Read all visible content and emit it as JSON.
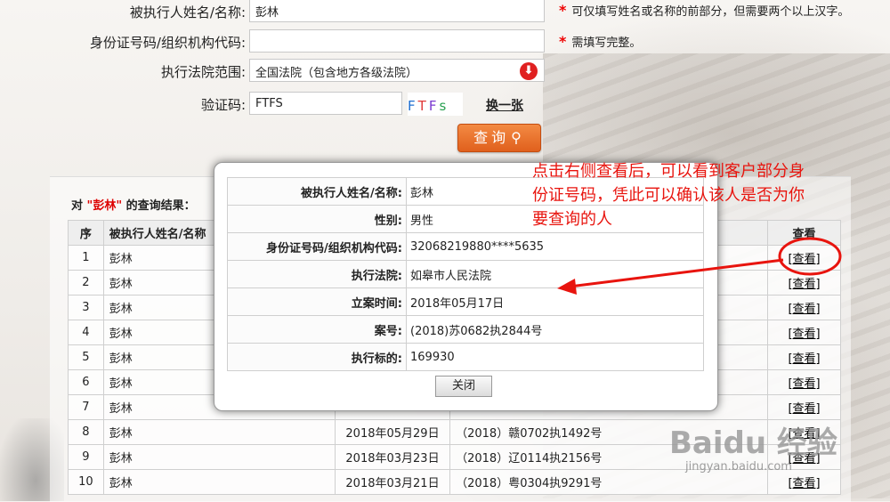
{
  "form": {
    "name_label": "被执行人姓名/名称:",
    "name_value": "彭林",
    "name_hint": "可仅填写姓名或名称的前部分，但需要两个以上汉字。",
    "id_label": "身份证号码/组织机构代码:",
    "id_value": "",
    "id_hint": "需填写完整。",
    "court_label": "执行法院范围:",
    "court_value": "全国法院（包含地方各级法院）",
    "captcha_label": "验证码:",
    "captcha_value": "FTFS",
    "captcha_chars": [
      "F",
      "T",
      "F",
      "s"
    ],
    "captcha_refresh": "换一张",
    "query_button": "查询"
  },
  "results": {
    "title_prefix": "对",
    "title_name": "\"彭林\"",
    "title_suffix": "的查询结果：",
    "headers": {
      "seq": "序",
      "name": "被执行人姓名/名称",
      "view": "查看"
    },
    "rows": [
      {
        "seq": "1",
        "name": "彭林",
        "date": "",
        "case": "",
        "view": "[查看]"
      },
      {
        "seq": "2",
        "name": "彭林",
        "date": "",
        "case": "",
        "view": "[查看]"
      },
      {
        "seq": "3",
        "name": "彭林",
        "date": "",
        "case": "",
        "view": "[查看]"
      },
      {
        "seq": "4",
        "name": "彭林",
        "date": "",
        "case": "",
        "view": "[查看]"
      },
      {
        "seq": "5",
        "name": "彭林",
        "date": "",
        "case": "",
        "view": "[查看]"
      },
      {
        "seq": "6",
        "name": "彭林",
        "date": "",
        "case": "",
        "view": "[查看]"
      },
      {
        "seq": "7",
        "name": "彭林",
        "date": "",
        "case": "",
        "view": "[查看]"
      },
      {
        "seq": "8",
        "name": "彭林",
        "date": "2018年05月29日",
        "case": "（2018）赣0702执1492号",
        "view": "[查看]"
      },
      {
        "seq": "9",
        "name": "彭林",
        "date": "2018年03月23日",
        "case": "（2018）辽0114执2156号",
        "view": "[查看]"
      },
      {
        "seq": "10",
        "name": "彭林",
        "date": "2018年03月21日",
        "case": "（2018）粤0304执9291号",
        "view": "[查看]"
      }
    ]
  },
  "detail": {
    "rows": [
      {
        "key": "被执行人姓名/名称:",
        "value": "彭林"
      },
      {
        "key": "性别:",
        "value": "男性"
      },
      {
        "key": "身份证号码/组织机构代码:",
        "value": "32068219880****5635"
      },
      {
        "key": "执行法院:",
        "value": "如皋市人民法院"
      },
      {
        "key": "立案时间:",
        "value": "2018年05月17日"
      },
      {
        "key": "案号:",
        "value": "(2018)苏0682执2844号"
      },
      {
        "key": "执行标的:",
        "value": "169930"
      }
    ],
    "close_button": "关闭"
  },
  "annotation": {
    "text": "点击右侧查看后，可以看到客户部分身份证号码，凭此可以确认该人是否为你要查询的人",
    "color": "#e8140e"
  },
  "watermark": {
    "brand": "Baidu 经验",
    "url": "jingyan.baidu.com"
  },
  "icons": {
    "select_arrow": "down-arrow-icon",
    "search": "magnifier-icon"
  },
  "colors": {
    "accent": "#e0601d",
    "red": "#e00000"
  }
}
